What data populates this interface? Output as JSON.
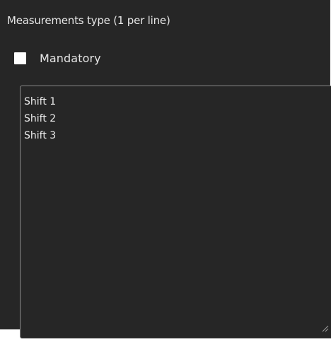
{
  "form": {
    "measurements_label": "Measurements type (1 per line)",
    "mandatory_label": "Mandatory",
    "mandatory_checked": false,
    "measurement_lines": [
      "Shift 1",
      "Shift 2",
      "Shift 3"
    ]
  },
  "icons": {
    "checkbox": "checkbox-unchecked-icon",
    "resize": "resize-grip-icon"
  }
}
